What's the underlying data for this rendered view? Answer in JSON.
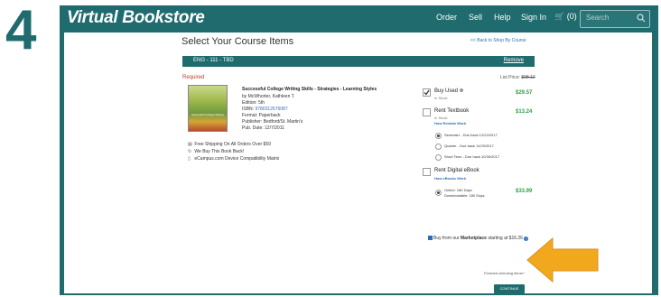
{
  "step": {
    "number": "4"
  },
  "header": {
    "brand": "Virtual Bookstore",
    "nav": [
      "Order",
      "Sell",
      "Help",
      "Sign In"
    ],
    "cart_label": "(0)",
    "search_placeholder": "Search"
  },
  "page": {
    "title": "Select Your Course Items",
    "back_link": "<< Back to Shop By Course"
  },
  "course": {
    "code": "ENG - 111    - TBD",
    "remove_label": "Remove",
    "required_label": "Required",
    "list_price_label": "List Price:",
    "list_price_value": "$98.12"
  },
  "book": {
    "cover_text": "Successful College Writing",
    "title": "Successful College Writing Skills - Strategies - Learning Styles",
    "author": "by McWhorter, Kathleen T.",
    "edition": "Edition: 5th",
    "isbn_label": "ISBN:",
    "isbn_value": "9780312676087",
    "format": "Format: Paperback",
    "publisher": "Publisher: Bedford/St. Martin's",
    "pub_date": "Pub. Date: 12/7/2011"
  },
  "perks": [
    {
      "icon": "truck-icon",
      "text": "Free Shipping On All Orders Over $59"
    },
    {
      "icon": "return-icon",
      "text": "We Buy This Book Back!"
    },
    {
      "icon": "device-icon",
      "text": "eCampus.com Device Compatibility Matrix"
    }
  ],
  "options": {
    "buy_used": {
      "label": "Buy Used",
      "sub": "In Stock",
      "price": "$29.57",
      "checked": true
    },
    "rent_textbook": {
      "label": "Rent Textbook",
      "sub": "In Stock",
      "link": "How Rentals Work",
      "price": "$13.24",
      "checked": false
    },
    "rental_terms": [
      {
        "label": "Semester - Due back 12/22/2017",
        "selected": true
      },
      {
        "label": "Quarter - Due back 11/29/2017",
        "selected": false
      },
      {
        "label": "Short Term - Due back 10/30/2017",
        "selected": false
      }
    ],
    "rent_ebook": {
      "label": "Rent Digital eBook",
      "link": "How eBooks Work",
      "checked": false
    },
    "ebook_terms": [
      {
        "label": "Online: 180 Days",
        "sub": "Downloadable: 180 Days",
        "price": "$33.99",
        "selected": true
      }
    ]
  },
  "marketplace": {
    "prefix": "Buy from our",
    "brand": "Marketplace",
    "suffix": "starting at $16.26"
  },
  "footer": {
    "finished_text": "Finished selecting items?",
    "continue_label": "CONTINUE"
  },
  "colors": {
    "brand_teal": "#1f6b6e",
    "price_green": "#2ea043",
    "required_red": "#c0392b",
    "arrow_orange": "#f2a81d"
  }
}
